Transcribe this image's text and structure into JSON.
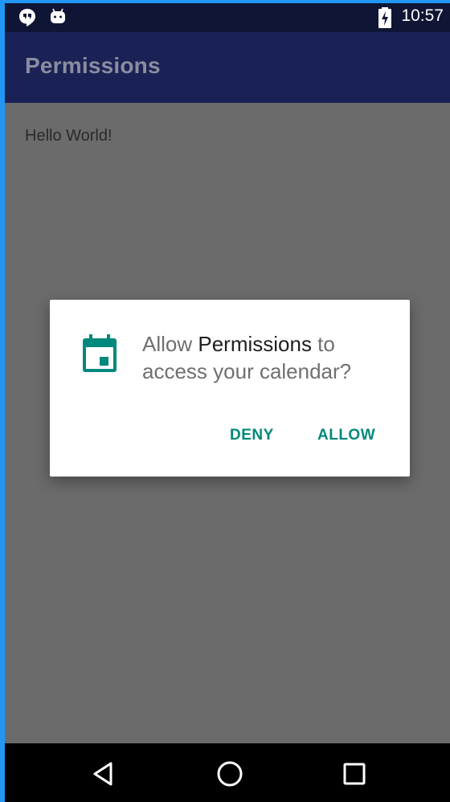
{
  "status_bar": {
    "time": "10:57",
    "icons": [
      "hangouts-icon",
      "android-debug-icon",
      "battery-charging-icon"
    ]
  },
  "app_bar": {
    "title": "Permissions"
  },
  "content": {
    "text": "Hello World!"
  },
  "dialog": {
    "icon": "calendar-icon",
    "message_prefix": "Allow ",
    "app_name": "Permissions",
    "message_suffix": " to access your calendar?",
    "deny_label": "DENY",
    "allow_label": "ALLOW",
    "accent_color": "#00897b"
  },
  "nav_bar": {
    "buttons": [
      "back-icon",
      "home-icon",
      "recents-icon"
    ]
  }
}
